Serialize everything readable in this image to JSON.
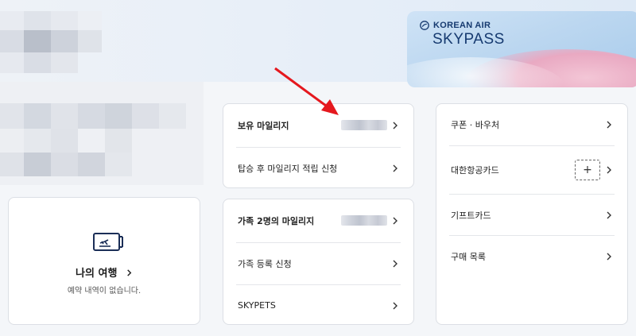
{
  "skypass_card": {
    "brand": "KOREAN AIR",
    "title": "SKYPASS"
  },
  "mileage_panel": {
    "rows": [
      {
        "label": "보유 마일리지"
      },
      {
        "label": "탑승 후 마일리지 적립 신청"
      }
    ]
  },
  "family_panel": {
    "rows": [
      {
        "label": "가족 2명의 마일리지"
      },
      {
        "label": "가족 등록 신청"
      },
      {
        "label": "SKYPETS"
      }
    ]
  },
  "trip_card": {
    "title": "나의 여행",
    "subtitle": "예약 내역이 없습니다."
  },
  "benefits_panel": {
    "rows": [
      {
        "label": "쿠폰 · 바우처"
      },
      {
        "label": "대한항공카드",
        "add_label": "+"
      },
      {
        "label": "기프트카드"
      },
      {
        "label": "구매 목록"
      }
    ]
  },
  "colors": {
    "accent_arrow": "#e5181e",
    "brand_navy": "#163a70"
  },
  "icons": {
    "chevron": "chevron-right-icon",
    "trip": "boarding-pass-icon",
    "logo": "korean-air-logo-icon"
  }
}
